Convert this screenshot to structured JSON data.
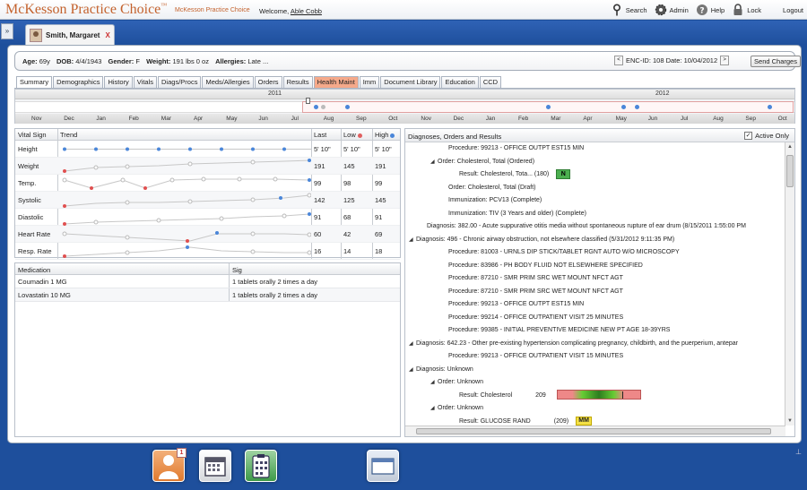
{
  "app": {
    "brand": "McKesson Practice Choice",
    "brand_tm": "™",
    "brand_small": "McKesson Practice Choice",
    "welcome_label": "Welcome,",
    "user": "Able Cobb"
  },
  "topnav": {
    "search": "Search",
    "admin": "Admin",
    "help": "Help",
    "lock": "Lock",
    "logout": "Logout"
  },
  "patient_tab": {
    "name": "Smith, Margaret",
    "close": "X"
  },
  "info": {
    "age_label": "Age:",
    "age": "69y",
    "dob_label": "DOB:",
    "dob": "4/4/1943",
    "gender_label": "Gender:",
    "gender": "F",
    "weight_label": "Weight:",
    "weight": "191 lbs 0 oz",
    "allergies_label": "Allergies:",
    "allergies": "Late ...",
    "enc": "ENC-ID: 108 Date: 10/04/2012",
    "prev": "<",
    "next": ">",
    "send": "Send Charges"
  },
  "tabs": [
    "Summary",
    "Demographics",
    "History",
    "Vitals",
    "Diags/Procs",
    "Meds/Allergies",
    "Orders",
    "Results",
    "Health Maint",
    "Imm",
    "Document Library",
    "Education",
    "CCD"
  ],
  "timeline": {
    "year1": "2011",
    "year2": "2012",
    "months": [
      "Nov",
      "Dec",
      "Jan",
      "Feb",
      "Mar",
      "Apr",
      "May",
      "Jun",
      "Jul",
      "Aug",
      "Sep",
      "Oct",
      "Nov",
      "Dec",
      "Jan",
      "Feb",
      "Mar",
      "Apr",
      "May",
      "Jun",
      "Jul",
      "Aug",
      "Sep",
      "Oct"
    ]
  },
  "vitals": {
    "headers": {
      "name": "Vital Sign",
      "trend": "Trend",
      "last": "Last",
      "low": "Low",
      "high": "High"
    },
    "rows": [
      {
        "name": "Height",
        "last": "5' 10\"",
        "low": "5' 10\"",
        "high": "5' 10\""
      },
      {
        "name": "Weight",
        "last": "191",
        "low": "145",
        "high": "191"
      },
      {
        "name": "Temp.",
        "last": "99",
        "low": "98",
        "high": "99"
      },
      {
        "name": "Systolic",
        "last": "142",
        "low": "125",
        "high": "145"
      },
      {
        "name": "Diastolic",
        "last": "91",
        "low": "68",
        "high": "91"
      },
      {
        "name": "Heart Rate",
        "last": "60",
        "low": "42",
        "high": "69"
      },
      {
        "name": "Resp. Rate",
        "last": "16",
        "low": "14",
        "high": "18"
      }
    ]
  },
  "meds": {
    "headers": {
      "medication": "Medication",
      "sig": "Sig"
    },
    "rows": [
      {
        "medication": "Coumadin 1 MG",
        "sig": "1 tablets orally 2 times a day"
      },
      {
        "medication": "Lovastatin 10 MG",
        "sig": "1 tablets orally 2 times a day"
      }
    ]
  },
  "diag": {
    "title": "Diagnoses, Orders and Results",
    "active_only": "Active Only",
    "lines": [
      {
        "indent": 3,
        "tri": "",
        "text": "Procedure: 99213 - OFFICE OUTPT EST15 MIN"
      },
      {
        "indent": 2,
        "tri": "◢",
        "text": "Order: Cholesterol, Total (Ordered)"
      },
      {
        "indent": 4,
        "tri": "",
        "text": "Result: Cholesterol, Tota... (180)",
        "badge": "N"
      },
      {
        "indent": 3,
        "tri": "",
        "text": "Order: Cholesterol, Total (Draft)"
      },
      {
        "indent": 3,
        "tri": "",
        "text": "Immunization: PCV13 (Complete)"
      },
      {
        "indent": 3,
        "tri": "",
        "text": "Immunization: TIV (3 Years and older) (Complete)"
      },
      {
        "indent": 1,
        "tri": "",
        "text": "Diagnosis: 382.00 - Acute suppurative otitis media without spontaneous rupture of ear drum (8/15/2011 1:55:00 PM"
      },
      {
        "indent": 0,
        "tri": "◢",
        "text": "Diagnosis: 496 - Chronic airway obstruction, not elsewhere classified (5/31/2012 9:11:35 PM)"
      },
      {
        "indent": 3,
        "tri": "",
        "text": "Procedure: 81003 - URNLS DIP STICK/TABLET RGNT AUTO W/O MICROSCOPY"
      },
      {
        "indent": 3,
        "tri": "",
        "text": "Procedure: 83986 - PH BODY FLUID NOT ELSEWHERE SPECIFIED"
      },
      {
        "indent": 3,
        "tri": "",
        "text": "Procedure: 87210 - SMR PRIM SRC WET MOUNT NFCT AGT"
      },
      {
        "indent": 3,
        "tri": "",
        "text": "Procedure: 87210 - SMR PRIM SRC WET MOUNT NFCT AGT"
      },
      {
        "indent": 3,
        "tri": "",
        "text": "Procedure: 99213 - OFFICE OUTPT EST15 MIN"
      },
      {
        "indent": 3,
        "tri": "",
        "text": "Procedure: 99214 - OFFICE OUTPATIENT VISIT 25 MINUTES"
      },
      {
        "indent": 3,
        "tri": "",
        "text": "Procedure: 99385 - INITIAL PREVENTIVE MEDICINE NEW PT AGE 18-39YRS"
      },
      {
        "indent": 0,
        "tri": "◢",
        "text": "Diagnosis: 642.23 - Other pre-existing hypertension complicating pregnancy, childbirth, and the puerperium, antepar"
      },
      {
        "indent": 3,
        "tri": "",
        "text": "Procedure: 99213 - OFFICE OUTPATIENT VISIT 15 MINUTES"
      },
      {
        "indent": 0,
        "tri": "◢",
        "text": "Diagnosis: Unknown"
      },
      {
        "indent": 2,
        "tri": "◢",
        "text": "Order: Unknown"
      },
      {
        "indent": 4,
        "tri": "",
        "text": "Result: Cholesterol",
        "value": "209",
        "range": true
      },
      {
        "indent": 2,
        "tri": "◢",
        "text": "Order: Unknown"
      },
      {
        "indent": 4,
        "tri": "",
        "text": "Result: GLUCOSE RAND",
        "value": "(209)",
        "badge_mm": "MM"
      }
    ]
  },
  "dock": {
    "badge": "1"
  },
  "colors": {
    "brand": "#c4622d",
    "accent": "#1e4f9c",
    "dot_blue": "#4a86d9",
    "dot_red": "#e05050",
    "dot_gray": "#bdbdbd"
  }
}
